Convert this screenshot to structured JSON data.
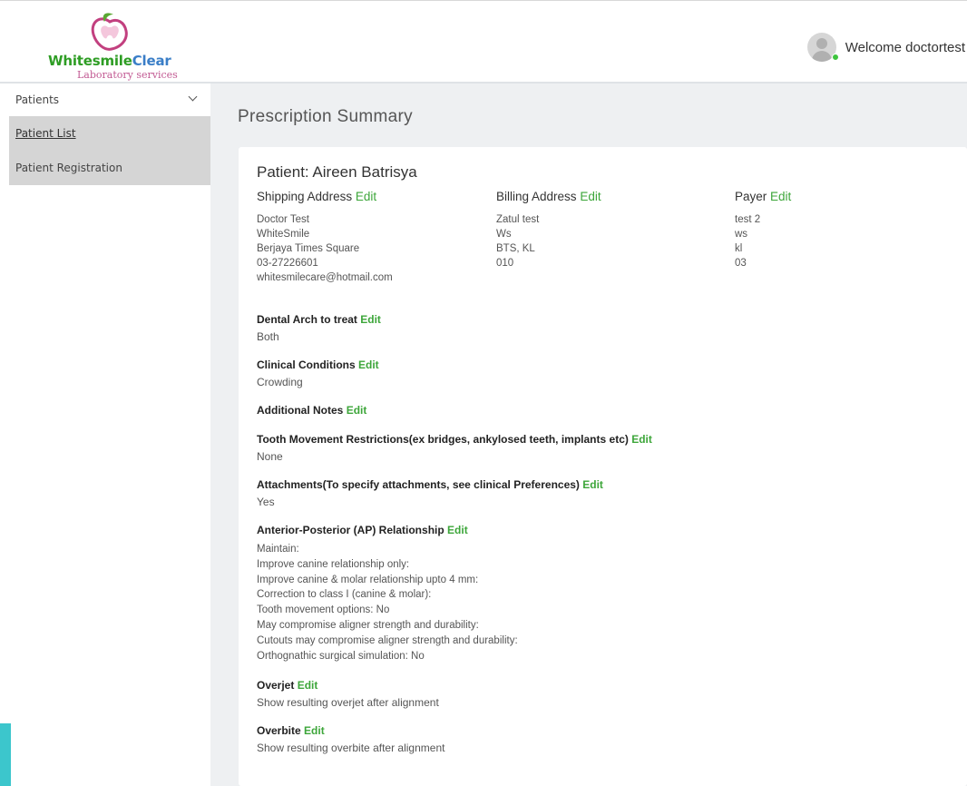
{
  "brand": {
    "name_part1": "Whitesmile",
    "name_part2": "Clear",
    "tagline": "Laboratory services"
  },
  "header": {
    "welcome": "Welcome doctortest"
  },
  "sidebar": {
    "group_label": "Patients",
    "items": [
      {
        "label": "Patient List",
        "active": true
      },
      {
        "label": "Patient Registration",
        "active": false
      }
    ]
  },
  "page": {
    "title": "Prescription Summary"
  },
  "patient": {
    "label": "Patient: Aireen Batrisya"
  },
  "edit_label": "Edit",
  "addresses": [
    {
      "title": "Shipping Address",
      "lines": [
        "Doctor Test",
        "WhiteSmile",
        "Berjaya Times Square",
        "03-27226601",
        "whitesmilecare@hotmail.com"
      ]
    },
    {
      "title": "Billing Address",
      "lines": [
        "Zatul test",
        "Ws",
        "BTS, KL",
        "010"
      ]
    },
    {
      "title": "Payer",
      "lines": [
        "test 2",
        "ws",
        "kl",
        "03"
      ]
    }
  ],
  "sections": [
    {
      "title": "Dental Arch to treat",
      "values": [
        "Both"
      ]
    },
    {
      "title": "Clinical Conditions",
      "values": [
        "Crowding"
      ]
    },
    {
      "title": "Additional Notes",
      "values": [
        ""
      ]
    },
    {
      "title": "Tooth Movement Restrictions(ex bridges, ankylosed teeth, implants etc)",
      "values": [
        "None"
      ]
    },
    {
      "title": "Attachments(To specify attachments, see clinical Preferences)",
      "values": [
        "Yes"
      ]
    },
    {
      "title": "Anterior-Posterior (AP) Relationship",
      "values": [
        "Maintain:",
        "Improve canine relationship only:",
        "Improve canine & molar relationship upto 4 mm:",
        "Correction to class I (canine & molar):",
        "Tooth movement options: No",
        "May compromise aligner strength and durability:",
        "Cutouts may compromise aligner strength and durability:",
        "Orthognathic surgical simulation: No"
      ]
    },
    {
      "title": "Overjet",
      "values": [
        "Show resulting overjet after alignment"
      ]
    },
    {
      "title": "Overbite",
      "values": [
        "Show resulting overbite after alignment"
      ]
    }
  ],
  "colors": {
    "edit": "#3da63a",
    "sidebar_item_bg": "#d5d5d5",
    "main_bg": "#eef0f2",
    "accent_teal": "#3cc6cc",
    "online": "#3ec43e"
  }
}
